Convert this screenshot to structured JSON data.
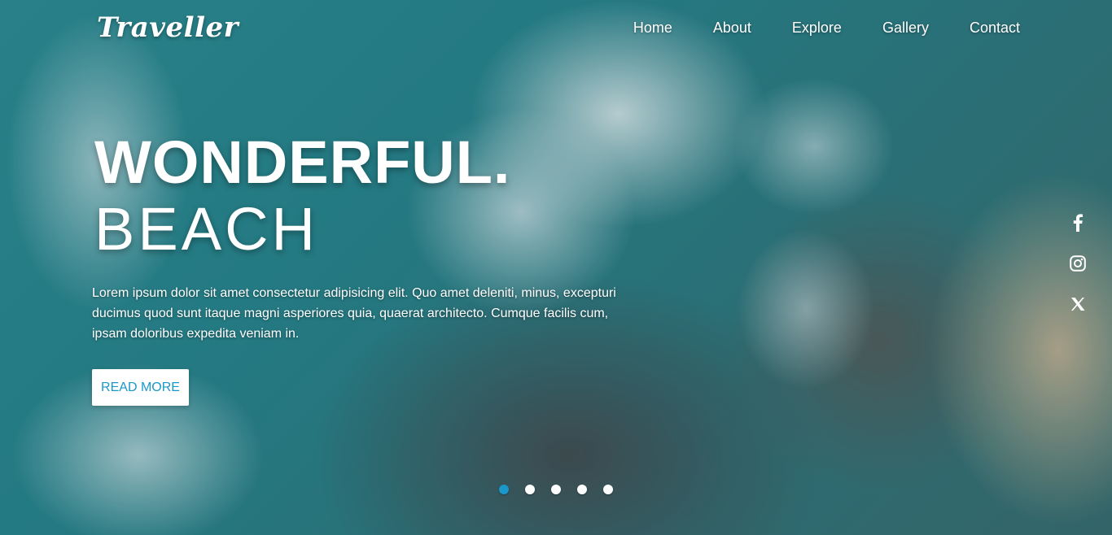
{
  "brand": {
    "logo": "Traveller"
  },
  "nav": {
    "items": [
      {
        "label": "Home"
      },
      {
        "label": "About"
      },
      {
        "label": "Explore"
      },
      {
        "label": "Gallery"
      },
      {
        "label": "Contact"
      }
    ]
  },
  "hero": {
    "headline": "WONDERFUL.",
    "subheadline": "BEACH",
    "description": "Lorem ipsum dolor sit amet consectetur adipisicing elit. Quo amet deleniti, minus, excepturi ducimus quod sunt itaque magni asperiores quia, quaerat architecto. Cumque facilis cum, ipsam doloribus expedita veniam in.",
    "button_label": "READ MORE"
  },
  "social": {
    "icons": [
      "facebook-icon",
      "instagram-icon",
      "x-twitter-icon"
    ]
  },
  "slider": {
    "count": 5,
    "active_index": 0
  },
  "colors": {
    "accent": "#1a98c9",
    "button_bg": "#ffffff",
    "text": "#ffffff"
  }
}
